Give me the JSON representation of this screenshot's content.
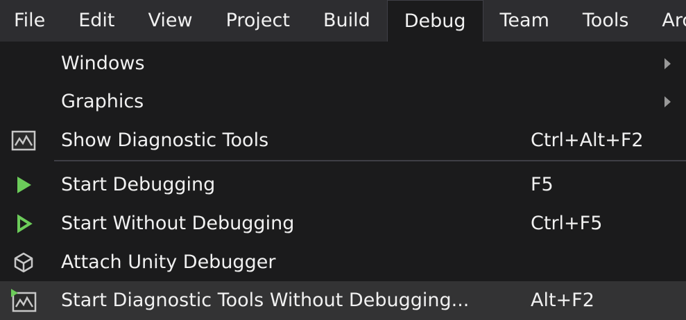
{
  "menubar": {
    "items": [
      {
        "label": "File"
      },
      {
        "label": "Edit"
      },
      {
        "label": "View"
      },
      {
        "label": "Project"
      },
      {
        "label": "Build"
      },
      {
        "label": "Debug",
        "active": true
      },
      {
        "label": "Team"
      },
      {
        "label": "Tools"
      },
      {
        "label": "Arc"
      }
    ]
  },
  "debug_menu": {
    "items": [
      {
        "label": "Windows",
        "shortcut": "",
        "submenu": true,
        "icon": ""
      },
      {
        "label": "Graphics",
        "shortcut": "",
        "submenu": true,
        "icon": ""
      },
      {
        "label": "Show Diagnostic Tools",
        "shortcut": "Ctrl+Alt+F2",
        "icon": "diagnostic-chart-icon"
      },
      {
        "label": "Start Debugging",
        "shortcut": "F5",
        "icon": "play-solid-icon"
      },
      {
        "label": "Start Without Debugging",
        "shortcut": "Ctrl+F5",
        "icon": "play-outline-icon"
      },
      {
        "label": "Attach Unity Debugger",
        "shortcut": "",
        "icon": "unity-cube-icon"
      },
      {
        "label": "Start Diagnostic Tools Without Debugging...",
        "shortcut": "Alt+F2",
        "icon": "diagnostic-play-chart-icon",
        "highlighted": true
      }
    ]
  },
  "colors": {
    "menubar_bg": "#2d2d30",
    "menu_bg": "#1b1b1c",
    "highlight_bg": "#333334",
    "text": "#f1f1f1",
    "play_green": "#6ccc5a",
    "separator": "#3f3f46"
  }
}
